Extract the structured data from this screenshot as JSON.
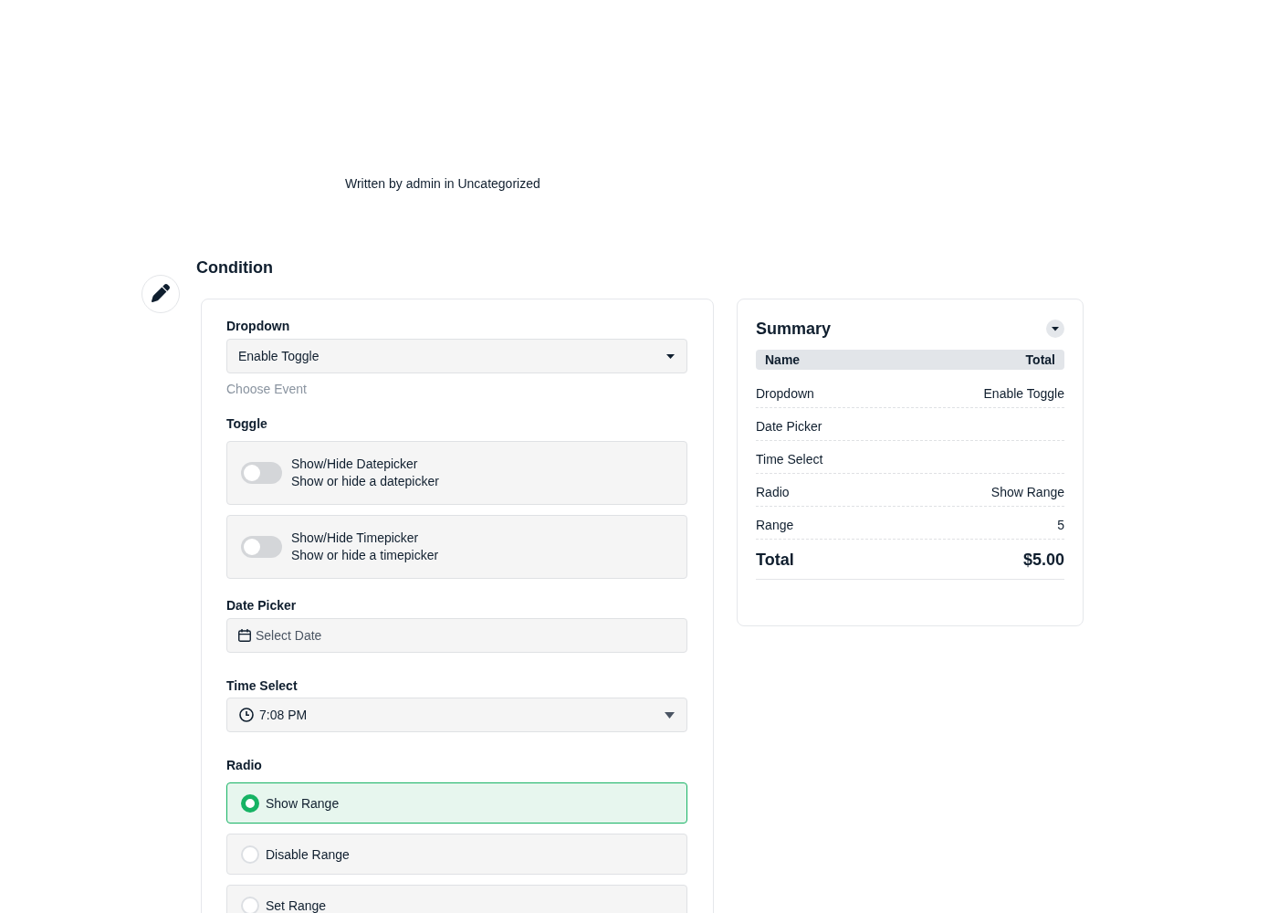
{
  "post_meta": {
    "text": "Written by admin in Uncategorized"
  },
  "section": {
    "title": "Condition"
  },
  "form": {
    "dropdown": {
      "label": "Dropdown",
      "value": "Enable Toggle",
      "hint": "Choose Event"
    },
    "toggle": {
      "label": "Toggle",
      "options": [
        {
          "title": "Show/Hide Datepicker",
          "description": "Show or hide a datepicker",
          "on": false
        },
        {
          "title": "Show/Hide Timepicker",
          "description": "Show or hide a timepicker",
          "on": false
        }
      ]
    },
    "date_picker": {
      "label": "Date Picker",
      "placeholder": "Select Date"
    },
    "time_select": {
      "label": "Time Select",
      "value": "7:08 PM"
    },
    "radio": {
      "label": "Radio",
      "options": [
        {
          "label": "Show Range",
          "selected": true
        },
        {
          "label": "Disable Range",
          "selected": false
        },
        {
          "label": "Set Range",
          "selected": false
        }
      ]
    }
  },
  "summary": {
    "title": "Summary",
    "columns": [
      "Name",
      "Total"
    ],
    "rows": [
      {
        "name": "Dropdown",
        "value": "Enable Toggle"
      },
      {
        "name": "Date Picker"
      },
      {
        "name": "Time Select"
      },
      {
        "name": "Radio",
        "value": "Show Range"
      },
      {
        "name": "Range",
        "value": "5"
      }
    ],
    "total": {
      "label": "Total",
      "value": "$5.00"
    }
  }
}
